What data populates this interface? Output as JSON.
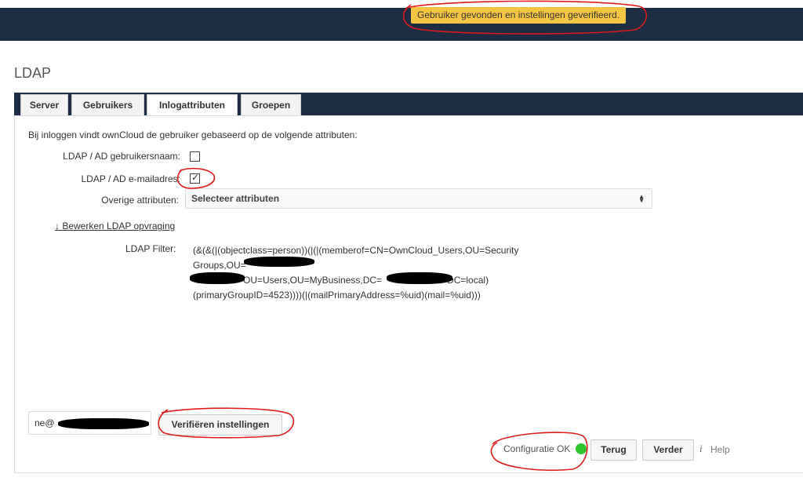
{
  "header": {
    "notification": "Gebruiker gevonden en instellingen geverifieerd."
  },
  "page": {
    "title": "LDAP"
  },
  "tabs": [
    {
      "label": "Server",
      "active": false
    },
    {
      "label": "Gebruikers",
      "active": false
    },
    {
      "label": "Inlogattributen",
      "active": true
    },
    {
      "label": "Groepen",
      "active": false
    }
  ],
  "login_attributes": {
    "description": "Bij inloggen vindt ownCloud de gebruiker gebaseerd op de volgende attributen:",
    "username_label": "LDAP / AD gebruikersnaam:",
    "username_checked": false,
    "email_label": "LDAP / AD e-mailadres:",
    "email_checked": true,
    "other_label": "Overige attributen:",
    "other_select_value": "Selecteer attributen",
    "edit_query_link": "↓ Bewerken LDAP opvraging",
    "filter_label": "LDAP Filter:",
    "filter_line_1": "(&(&(|(objectclass=person))(|(|(memberof=CN=OwnCloud_Users,OU=Security",
    "filter_line_2": "Groups,OU=",
    "filter_line_3a": "OU=Users,OU=MyBusiness,DC=",
    "filter_line_3b": "DC=local)",
    "filter_line_4": "(primaryGroupID=4523))))(|(mailPrimaryAddress=%uid)(mail=%uid)))"
  },
  "footer": {
    "test_input_value": "ne@",
    "verify_button": "Verifiëren instellingen",
    "status_text": "Configuratie OK",
    "status_color": "#2ec52e",
    "back_button": "Terug",
    "next_button": "Verder",
    "help_icon": "info-icon",
    "help_icon_glyph": "i",
    "help_text": "Help"
  }
}
